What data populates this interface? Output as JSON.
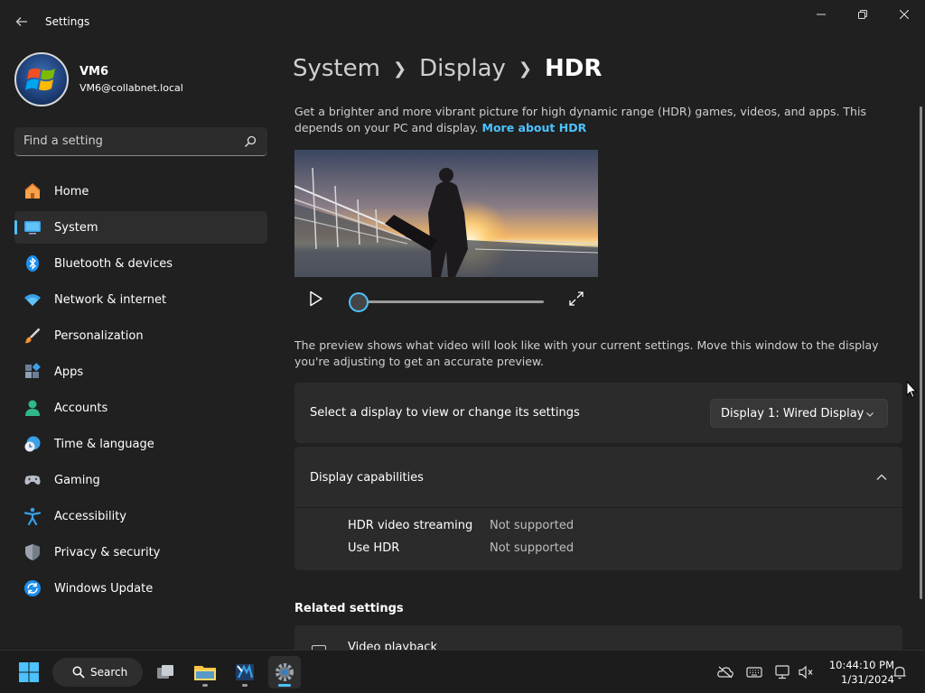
{
  "window": {
    "title": "Settings"
  },
  "profile": {
    "name": "VM6",
    "email": "VM6@collabnet.local"
  },
  "search": {
    "placeholder": "Find a setting"
  },
  "sidebar": {
    "items": [
      {
        "label": "Home",
        "icon": "home-icon"
      },
      {
        "label": "System",
        "icon": "system-icon",
        "active": true
      },
      {
        "label": "Bluetooth & devices",
        "icon": "bluetooth-icon"
      },
      {
        "label": "Network & internet",
        "icon": "wifi-icon"
      },
      {
        "label": "Personalization",
        "icon": "brush-icon"
      },
      {
        "label": "Apps",
        "icon": "apps-icon"
      },
      {
        "label": "Accounts",
        "icon": "accounts-icon"
      },
      {
        "label": "Time & language",
        "icon": "clock-globe-icon"
      },
      {
        "label": "Gaming",
        "icon": "gamepad-icon"
      },
      {
        "label": "Accessibility",
        "icon": "accessibility-icon"
      },
      {
        "label": "Privacy & security",
        "icon": "shield-icon"
      },
      {
        "label": "Windows Update",
        "icon": "update-icon"
      }
    ]
  },
  "breadcrumb": {
    "items": [
      "System",
      "Display",
      "HDR"
    ]
  },
  "main": {
    "description": "Get a brighter and more vibrant picture for high dynamic range (HDR) games, videos, and apps. This depends on your PC and display.",
    "more_link": "More about HDR",
    "video_progress": 0,
    "preview_note": "The preview shows what video will look like with your current settings. Move this window to the display you're adjusting to get an accurate preview.",
    "select_display": {
      "label": "Select a display to view or change its settings",
      "value": "Display 1: Wired Display"
    },
    "capabilities": {
      "title": "Display capabilities",
      "expanded": true,
      "rows": [
        {
          "key": "HDR video streaming",
          "value": "Not supported"
        },
        {
          "key": "Use HDR",
          "value": "Not supported"
        }
      ]
    },
    "related": {
      "title": "Related settings",
      "items": [
        {
          "label": "Video playback"
        }
      ]
    }
  },
  "taskbar": {
    "search_label": "Search",
    "time": "10:44:10 PM",
    "date": "1/31/2024"
  },
  "colors": {
    "accent": "#4cc2ff",
    "background": "#202020",
    "card": "#2b2b2b"
  }
}
